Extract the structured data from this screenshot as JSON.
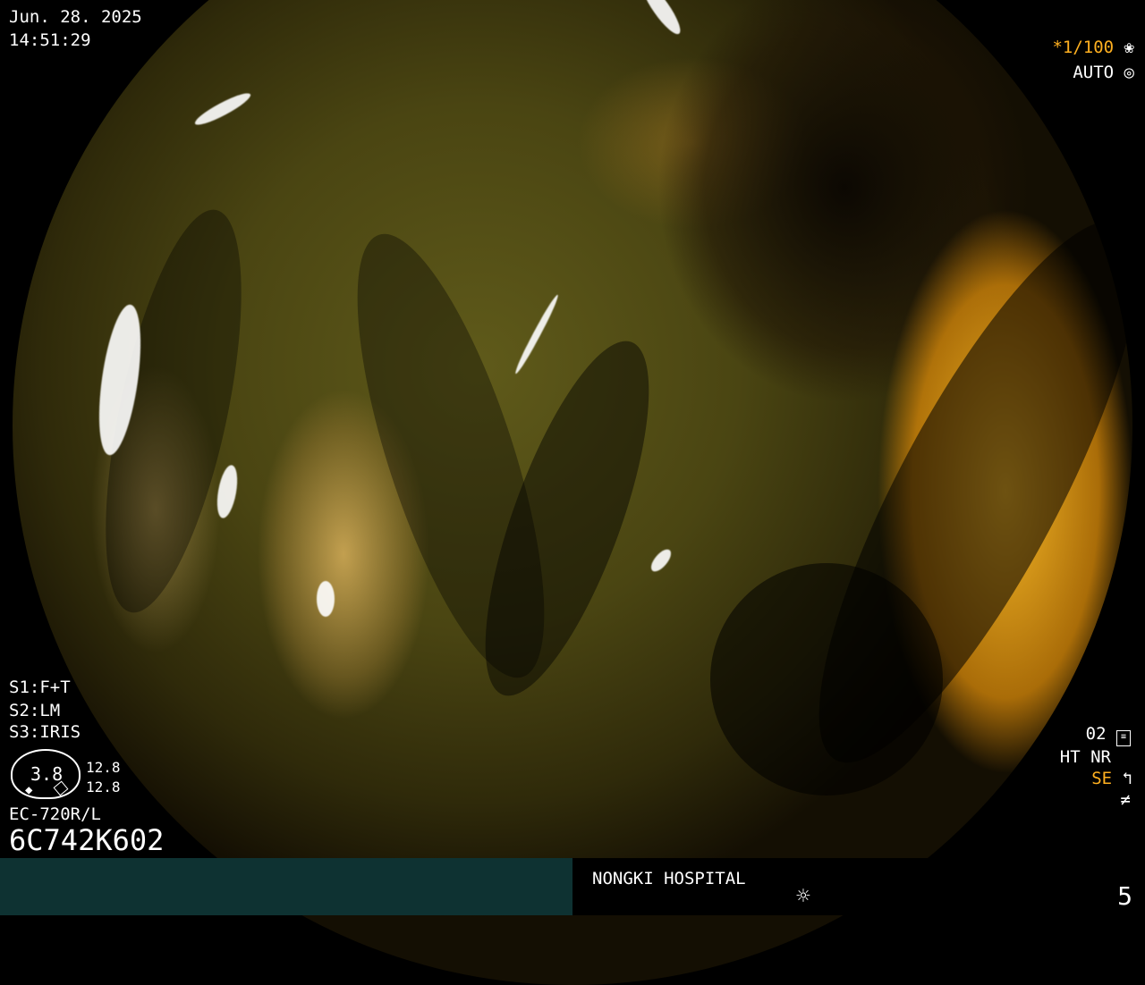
{
  "datetime": {
    "date": "Jun. 28. 2025",
    "time": "14:51:29"
  },
  "exposure": {
    "shutter": "*1/100",
    "mode": "AUTO"
  },
  "settings": {
    "s1": "S1:F+T",
    "s2": "S2:LM",
    "s3": "S3:IRIS"
  },
  "badge": {
    "value": "3.8",
    "top_value": "12.8",
    "bottom_value": "12.8"
  },
  "scope": {
    "model": "EC-720R/L",
    "serial": "6C742K602"
  },
  "right_panel": {
    "line1": "02",
    "line2": "HT NR",
    "line3": "SE"
  },
  "footer": {
    "hospital": "NONGKI HOSPITAL",
    "page_number": "5"
  },
  "icons": {
    "shutter_icon": "aperture-icon",
    "auto_icon": "camera-lens-icon",
    "settings_icon": "sliders-icon",
    "se_icon": "enhance-curve-icon",
    "filter_icon": "not-equal-icon",
    "brightness_icon": "sun-icon"
  },
  "colors": {
    "accent_orange": "#ffb020",
    "footer_bar": "#0e3232"
  }
}
